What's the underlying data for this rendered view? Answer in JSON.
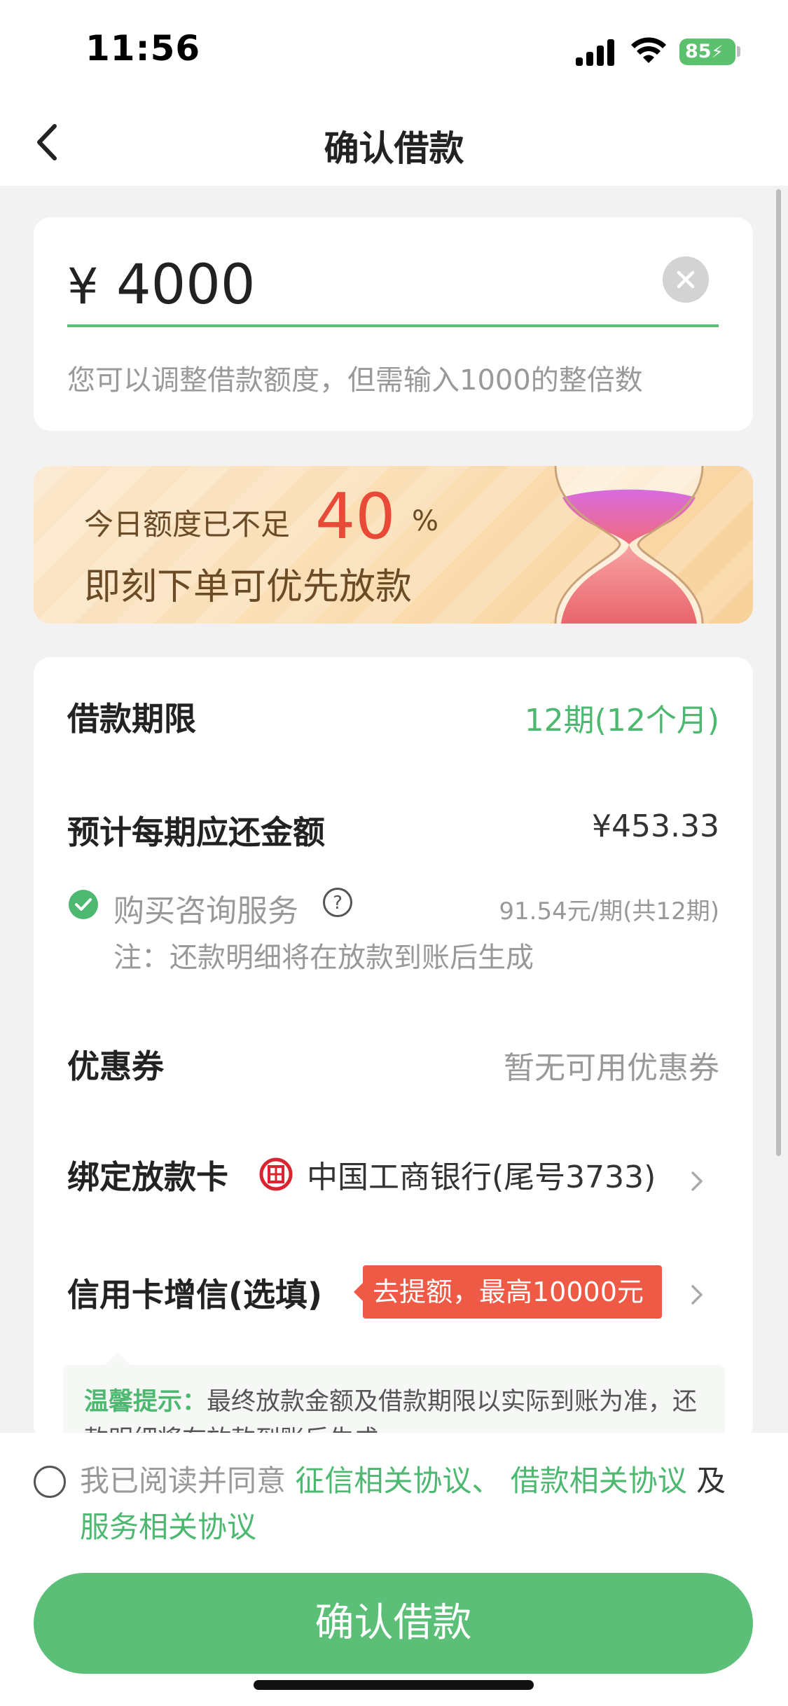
{
  "status_bar": {
    "time": "11:56",
    "battery": "85"
  },
  "nav": {
    "title": "确认借款"
  },
  "amount": {
    "currency": "¥",
    "value": "4000",
    "hint": "您可以调整借款额度，但需输入1000的整倍数"
  },
  "promo": {
    "line1": "今日额度已不足",
    "percent": "40",
    "percent_sign": "%",
    "line2": "即刻下单可优先放款"
  },
  "details": {
    "term_label": "借款期限",
    "term_value": "12期(12个月)",
    "payment_label": "预计每期应还金额",
    "payment_value": "¥453.33",
    "service_label": "购买咨询服务",
    "service_price": "91.54元/期(共12期)",
    "service_note": "注：还款明细将在放款到账后生成",
    "coupon_label": "优惠券",
    "coupon_value": "暂无可用优惠券",
    "card_label": "绑定放款卡",
    "card_value": "中国工商银行(尾号3733)",
    "credit_label": "信用卡增信(选填)",
    "credit_tag": "去提额，最高10000元",
    "tip_label": "温馨提示：",
    "tip_text": "最终放款金额及借款期限以实际到账为准，还款明细将在放款到账后生成"
  },
  "agreement": {
    "prefix": "我已阅读并同意",
    "link1": "征信相关协议、",
    "link2": "借款相关协议",
    "and": "及",
    "link3": "服务相关协议"
  },
  "confirm_button": "确认借款",
  "colors": {
    "brand_green": "#5bbf78",
    "accent_red": "#e94a37",
    "tag_red": "#ee5a45"
  }
}
